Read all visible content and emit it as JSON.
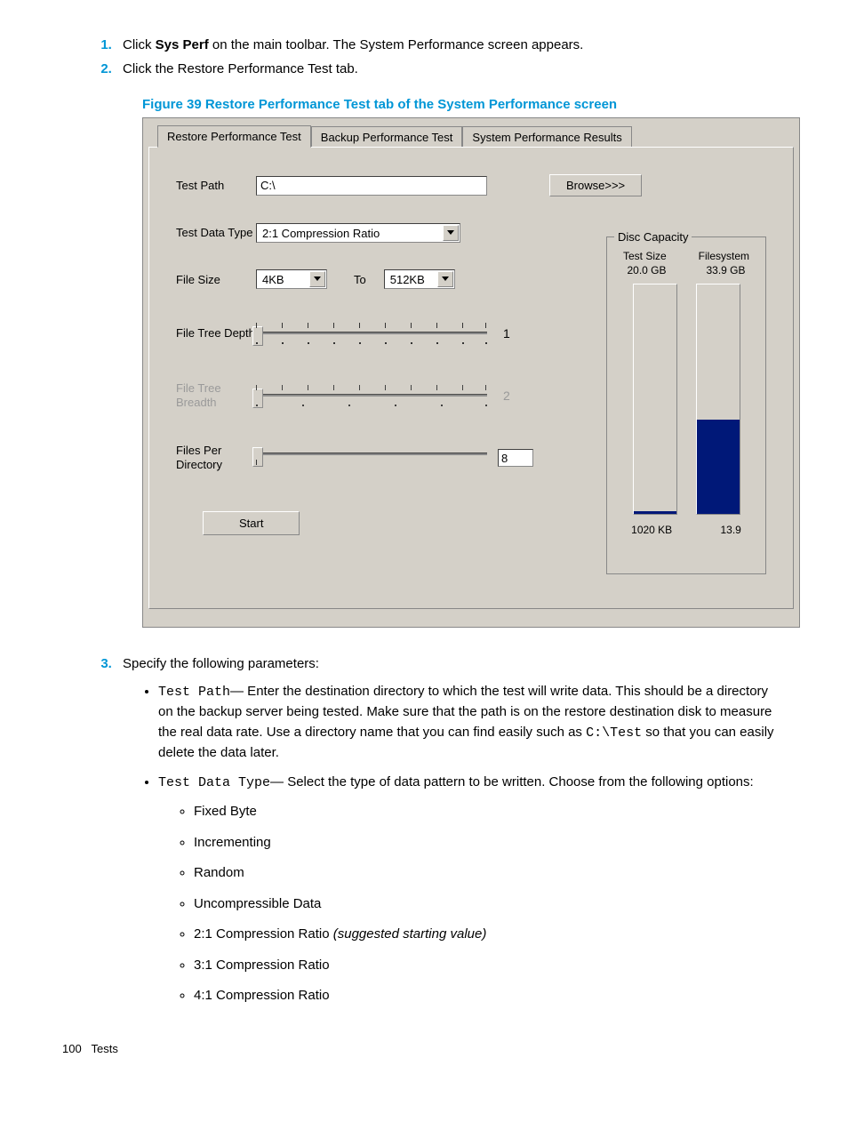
{
  "steps": {
    "s1_pre": "Click ",
    "s1_bold": "Sys Perf",
    "s1_post": " on the main toolbar. The System Performance screen appears.",
    "s2": "Click the Restore Performance Test tab.",
    "s3": "Specify the following parameters:"
  },
  "figure_caption": "Figure 39 Restore Performance Test tab of the System Performance screen",
  "tabs": {
    "t1": "Restore Performance Test",
    "t2": "Backup Performance Test",
    "t3": "System Performance Results"
  },
  "labels": {
    "test_path": "Test Path",
    "test_data_type": "Test Data Type",
    "file_size": "File Size",
    "to": "To",
    "file_tree_depth": "File Tree Depth",
    "file_tree_breadth": "File Tree Breadth",
    "files_per_directory": "Files Per Directory",
    "start": "Start",
    "browse": "Browse>>>"
  },
  "values": {
    "test_path": "C:\\",
    "test_data_type": "2:1 Compression Ratio",
    "file_size_from": "4KB",
    "file_size_to": "512KB",
    "file_tree_depth": "1",
    "file_tree_breadth": "2",
    "files_per_directory": "8"
  },
  "disc_capacity": {
    "legend": "Disc Capacity",
    "h1": "Test Size",
    "h2": "Filesystem",
    "v1": "20.0 GB",
    "v2": "33.9 GB",
    "b1": "1020 KB",
    "b2": "13.9"
  },
  "params": {
    "test_path_name": "Test Path",
    "test_path_desc1": "— Enter the destination directory to which the test will write data. This should be a directory on the backup server being tested. Make sure that the path is on the restore destination disk to measure the real data rate. Use a directory name that you can find easily such as ",
    "test_path_code": "C:\\Test",
    "test_path_desc2": " so that you can easily delete the data later.",
    "test_data_type_name": "Test Data Type",
    "test_data_type_desc": "— Select the type of data pattern to be written. Choose from the following options:",
    "opt1": "Fixed Byte",
    "opt2": "Incrementing",
    "opt3": "Random",
    "opt4": "Uncompressible Data",
    "opt5_pre": "2:1 Compression Ratio ",
    "opt5_it": "(suggested starting value)",
    "opt6": "3:1 Compression Ratio",
    "opt7": "4:1 Compression Ratio"
  },
  "footer": {
    "page": "100",
    "section": "Tests"
  }
}
